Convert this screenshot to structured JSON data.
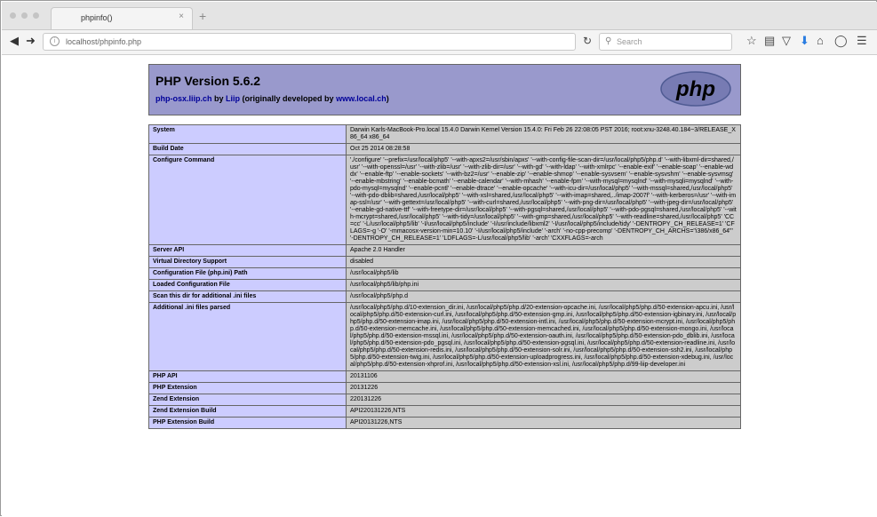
{
  "browser": {
    "tab_title": "phpinfo()",
    "tab_close": "×",
    "new_tab": "+",
    "url": "localhost/phpinfo.php",
    "search_placeholder": "Search"
  },
  "php": {
    "version_title": "PHP Version 5.6.2",
    "credits": {
      "site": "php-osx.liip.ch",
      "by": " by ",
      "author": "Liip",
      "middle": " (originally developed by ",
      "orig": "www.local.ch",
      "end": ")"
    },
    "logo_text": "php",
    "rows": [
      {
        "key": "System",
        "value": "Darwin Karls-MacBook-Pro.local 15.4.0 Darwin Kernel Version 15.4.0: Fri Feb 26 22:08:05 PST 2016; root:xnu-3248.40.184~3/RELEASE_X86_64 x86_64"
      },
      {
        "key": "Build Date",
        "value": "Oct 25 2014 08:28:58"
      },
      {
        "key": "Configure Command",
        "value": "'./configure' '--prefix=/usr/local/php5' '--with-apxs2=/usr/sbin/apxs' '--with-config-file-scan-dir=/usr/local/php5/php.d' '--with-libxml-dir=shared,/usr' '--with-openssl=/usr' '--with-zlib=/usr' '--with-zlib-dir=/usr' '--with-gd' '--with-ldap' '--with-xmlrpc' '--enable-exif' '--enable-soap' '--enable-wddx' '--enable-ftp' '--enable-sockets' '--with-bz2=/usr' '--enable-zip' '--enable-shmop' '--enable-sysvsem' '--enable-sysvshm' '--enable-sysvmsg' '--enable-mbstring' '--enable-bcmath' '--enable-calendar' '--with-mhash' '--enable-fpm' '--with-mysql=mysqlnd' '--with-mysqli=mysqlnd' '--with-pdo-mysql=mysqlnd' '--enable-pcntl' '--enable-dtrace' '--enable-opcache' '--with-icu-dir=/usr/local/php5' '--with-mssql=shared,/usr/local/php5' '--with-pdo-dblib=shared,/usr/local/php5' '--with-xsl=shared,/usr/local/php5' '--with-imap=shared,../imap-2007f' '--with-kerberos=/usr' '--with-imap-ssl=/usr' '--with-gettext=/usr/local/php5' '--with-curl=shared,/usr/local/php5' '--with-png-dir=/usr/local/php5' '--with-jpeg-dir=/usr/local/php5' '--enable-gd-native-ttf' '--with-freetype-dir=/usr/local/php5' '--with-pgsql=shared,/usr/local/php5' '--with-pdo-pgsql=shared,/usr/local/php5' '--with-mcrypt=shared,/usr/local/php5' '--with-tidy=/usr/local/php5' '--with-gmp=shared,/usr/local/php5' '--with-readline=shared,/usr/local/php5' 'CC=cc' '-L/usr/local/php5/lib' '-I/usr/local/php5/include' '-I/usr/include/libxml2' '-I/usr/local/php5/include/tidy' '-DENTROPY_CH_RELEASE=1' 'CFLAGS=-g '-O' '-mmacosx-version-min=10.10' '-I/usr/local/php5/include' '-arch' '-no-cpp-precomp' '-DENTROPY_CH_ARCHS=\"i386/x86_64\"' '-DENTROPY_CH_RELEASE=1' 'LDFLAGS=-L/usr/local/php5/lib' '-arch' 'CXXFLAGS=-arch"
      },
      {
        "key": "Server API",
        "value": "Apache 2.0 Handler"
      },
      {
        "key": "Virtual Directory Support",
        "value": "disabled"
      },
      {
        "key": "Configuration File (php.ini) Path",
        "value": "/usr/local/php5/lib"
      },
      {
        "key": "Loaded Configuration File",
        "value": "/usr/local/php5/lib/php.ini"
      },
      {
        "key": "Scan this dir for additional .ini files",
        "value": "/usr/local/php5/php.d"
      },
      {
        "key": "Additional .ini files parsed",
        "value": "/usr/local/php5/php.d/10-extension_dir.ini, /usr/local/php5/php.d/20-extension-opcache.ini, /usr/local/php5/php.d/50-extension-apcu.ini, /usr/local/php5/php.d/50-extension-curl.ini, /usr/local/php5/php.d/50-extension-gmp.ini, /usr/local/php5/php.d/50-extension-igbinary.ini, /usr/local/php5/php.d/50-extension-imap.ini, /usr/local/php5/php.d/50-extension-intl.ini, /usr/local/php5/php.d/50-extension-mcrypt.ini, /usr/local/php5/php.d/50-extension-memcache.ini, /usr/local/php5/php.d/50-extension-memcached.ini, /usr/local/php5/php.d/50-extension-mongo.ini, /usr/local/php5/php.d/50-extension-mssql.ini, /usr/local/php5/php.d/50-extension-oauth.ini, /usr/local/php5/php.d/50-extension-pdo_dblib.ini, /usr/local/php5/php.d/50-extension-pdo_pgsql.ini, /usr/local/php5/php.d/50-extension-pgsql.ini, /usr/local/php5/php.d/50-extension-readline.ini, /usr/local/php5/php.d/50-extension-redis.ini, /usr/local/php5/php.d/50-extension-solr.ini, /usr/local/php5/php.d/50-extension-ssh2.ini, /usr/local/php5/php.d/50-extension-twig.ini, /usr/local/php5/php.d/50-extension-uploadprogress.ini, /usr/local/php5/php.d/50-extension-xdebug.ini, /usr/local/php5/php.d/50-extension-xhprof.ini, /usr/local/php5/php.d/50-extension-xsl.ini, /usr/local/php5/php.d/99-liip-developer.ini"
      },
      {
        "key": "PHP API",
        "value": "20131106"
      },
      {
        "key": "PHP Extension",
        "value": "20131226"
      },
      {
        "key": "Zend Extension",
        "value": "220131226"
      },
      {
        "key": "Zend Extension Build",
        "value": "API220131226,NTS"
      },
      {
        "key": "PHP Extension Build",
        "value": "API20131226,NTS"
      }
    ]
  }
}
